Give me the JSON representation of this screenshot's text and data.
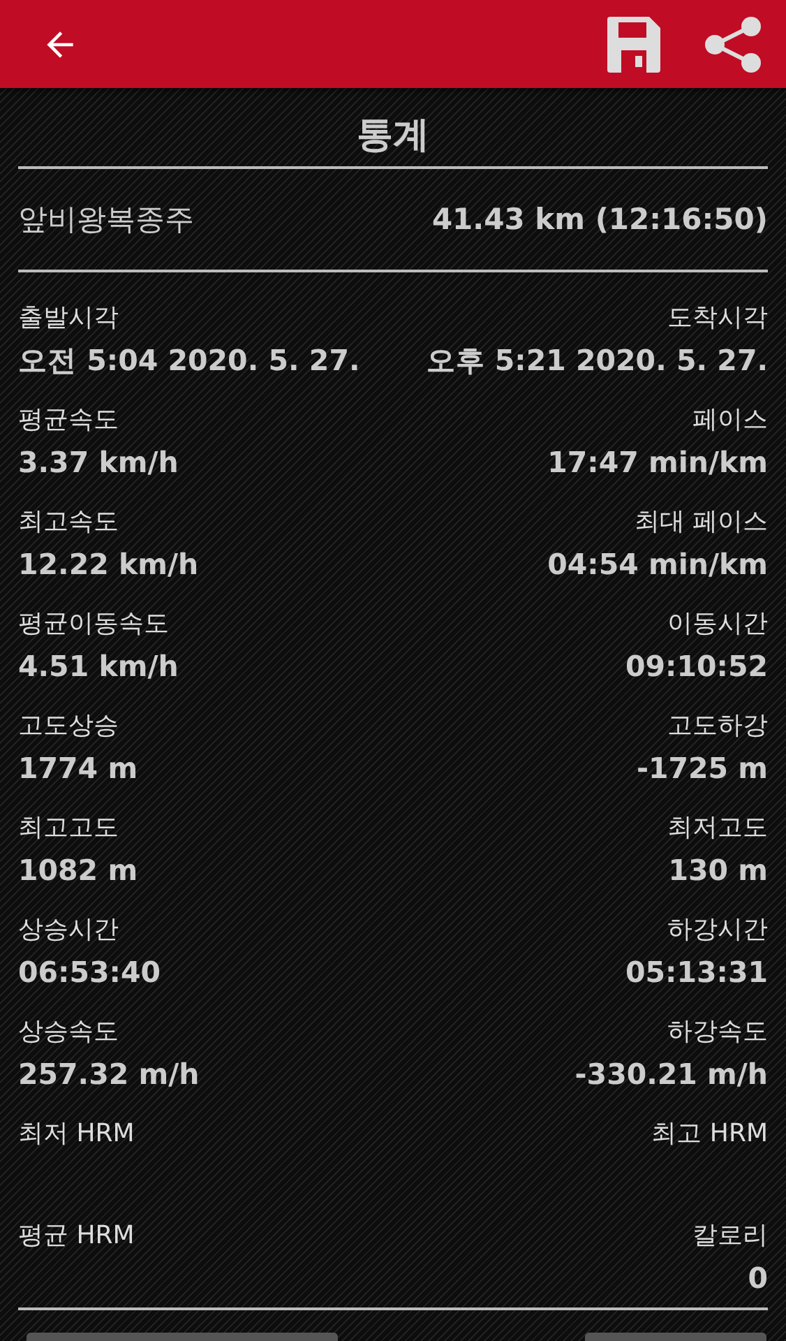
{
  "title": "통계",
  "summary": {
    "name": "앞비왕복종주",
    "value": "41.43 km (12:16:50)"
  },
  "stats": [
    {
      "left": {
        "label": "출발시각",
        "value": "오전 5:04 2020. 5. 27."
      },
      "right": {
        "label": "도착시각",
        "value": "오후 5:21 2020. 5. 27."
      }
    },
    {
      "left": {
        "label": "평균속도",
        "value": "3.37 km/h"
      },
      "right": {
        "label": "페이스",
        "value": "17:47 min/km"
      }
    },
    {
      "left": {
        "label": "최고속도",
        "value": "12.22 km/h"
      },
      "right": {
        "label": "최대 페이스",
        "value": "04:54 min/km"
      }
    },
    {
      "left": {
        "label": "평균이동속도",
        "value": "4.51 km/h"
      },
      "right": {
        "label": "이동시간",
        "value": "09:10:52"
      }
    },
    {
      "left": {
        "label": "고도상승",
        "value": "1774 m"
      },
      "right": {
        "label": "고도하강",
        "value": "-1725 m"
      }
    },
    {
      "left": {
        "label": "최고고도",
        "value": "1082 m"
      },
      "right": {
        "label": "최저고도",
        "value": "130 m"
      }
    },
    {
      "left": {
        "label": "상승시간",
        "value": "06:53:40"
      },
      "right": {
        "label": "하강시간",
        "value": "05:13:31"
      }
    },
    {
      "left": {
        "label": "상승속도",
        "value": "257.32 m/h"
      },
      "right": {
        "label": "하강속도",
        "value": "-330.21 m/h"
      }
    },
    {
      "left": {
        "label": "최저 HRM"
      },
      "right": {
        "label": "최고 HRM"
      }
    },
    {
      "left": {
        "label": "평균 HRM"
      },
      "right": {
        "label": "칼로리",
        "value": "0"
      }
    }
  ]
}
